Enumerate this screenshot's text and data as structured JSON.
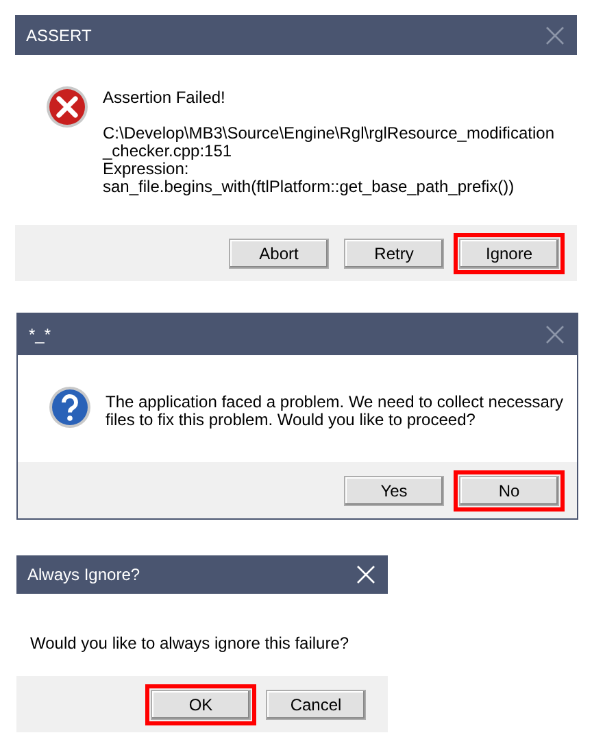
{
  "dialogs": [
    {
      "title": "ASSERT",
      "active": false,
      "kind": "error",
      "message": [
        [
          "Assertion Failed!"
        ],
        [
          "C:\\Develop\\MB3\\Source\\Engine\\Rgl\\rglResource_modification",
          "_checker.cpp:151",
          "Expression:",
          "san_file.begins_with(ftlPlatform::get_base_path_prefix())"
        ]
      ],
      "buttons": [
        {
          "label": "Abort",
          "highlighted": false
        },
        {
          "label": "Retry",
          "highlighted": false
        },
        {
          "label": "Ignore",
          "highlighted": true
        }
      ]
    },
    {
      "title": "*_*",
      "active": false,
      "kind": "question",
      "message": [
        [
          "The application faced a problem. We need to collect necessary",
          "files to fix this problem. Would you like to proceed?"
        ]
      ],
      "buttons": [
        {
          "label": "Yes",
          "highlighted": false
        },
        {
          "label": "No",
          "highlighted": true
        }
      ]
    },
    {
      "title": "Always Ignore?",
      "active": true,
      "kind": "plain",
      "message": [
        [
          "Would you like to always ignore this failure?"
        ]
      ],
      "buttons": [
        {
          "label": "OK",
          "highlighted": true
        },
        {
          "label": "Cancel",
          "highlighted": false
        }
      ]
    }
  ]
}
